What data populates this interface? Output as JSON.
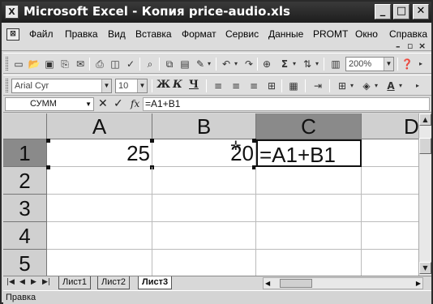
{
  "window": {
    "title": "Microsoft Excel - Копия price-audio.xls",
    "app_icon": "X",
    "minimize": "_",
    "maximize": "□",
    "close": "✕"
  },
  "menu": {
    "items": [
      "Файл",
      "Правка",
      "Вид",
      "Вставка",
      "Формат",
      "Сервис",
      "Данные",
      "PROMT",
      "Окно",
      "Справка"
    ],
    "doc_icon": "⊠"
  },
  "standard_toolbar": {
    "zoom": "200%",
    "icons": [
      "new-icon",
      "open-icon",
      "save-icon",
      "permission-icon",
      "email-icon",
      "print-icon",
      "print-preview-icon",
      "spelling-icon",
      "cut-icon",
      "copy-icon",
      "paste-icon",
      "format-painter-icon",
      "undo-icon",
      "hyperlink-icon",
      "autosum-icon",
      "sort-ascending-icon",
      "zoom-icon",
      "help-icon"
    ]
  },
  "format_toolbar": {
    "font": "Arial Cyr",
    "size": "10",
    "bold": "Ж",
    "italic": "К",
    "underline": "Ч"
  },
  "formula_bar": {
    "name_box": "СУММ",
    "cancel": "✕",
    "enter": "✓",
    "fx": "fx",
    "content": "=A1+B1"
  },
  "grid": {
    "columns": [
      "A",
      "B",
      "C",
      "D"
    ],
    "rows": [
      "1",
      "2",
      "3",
      "4",
      "5"
    ],
    "cells": {
      "A1": "25",
      "B1": "20",
      "C1": "=A1+B1"
    }
  },
  "sheets": {
    "tabs": [
      "Лист1",
      "Лист2",
      "Лист3"
    ],
    "active": "Лист3"
  },
  "status": {
    "text": "Правка"
  }
}
